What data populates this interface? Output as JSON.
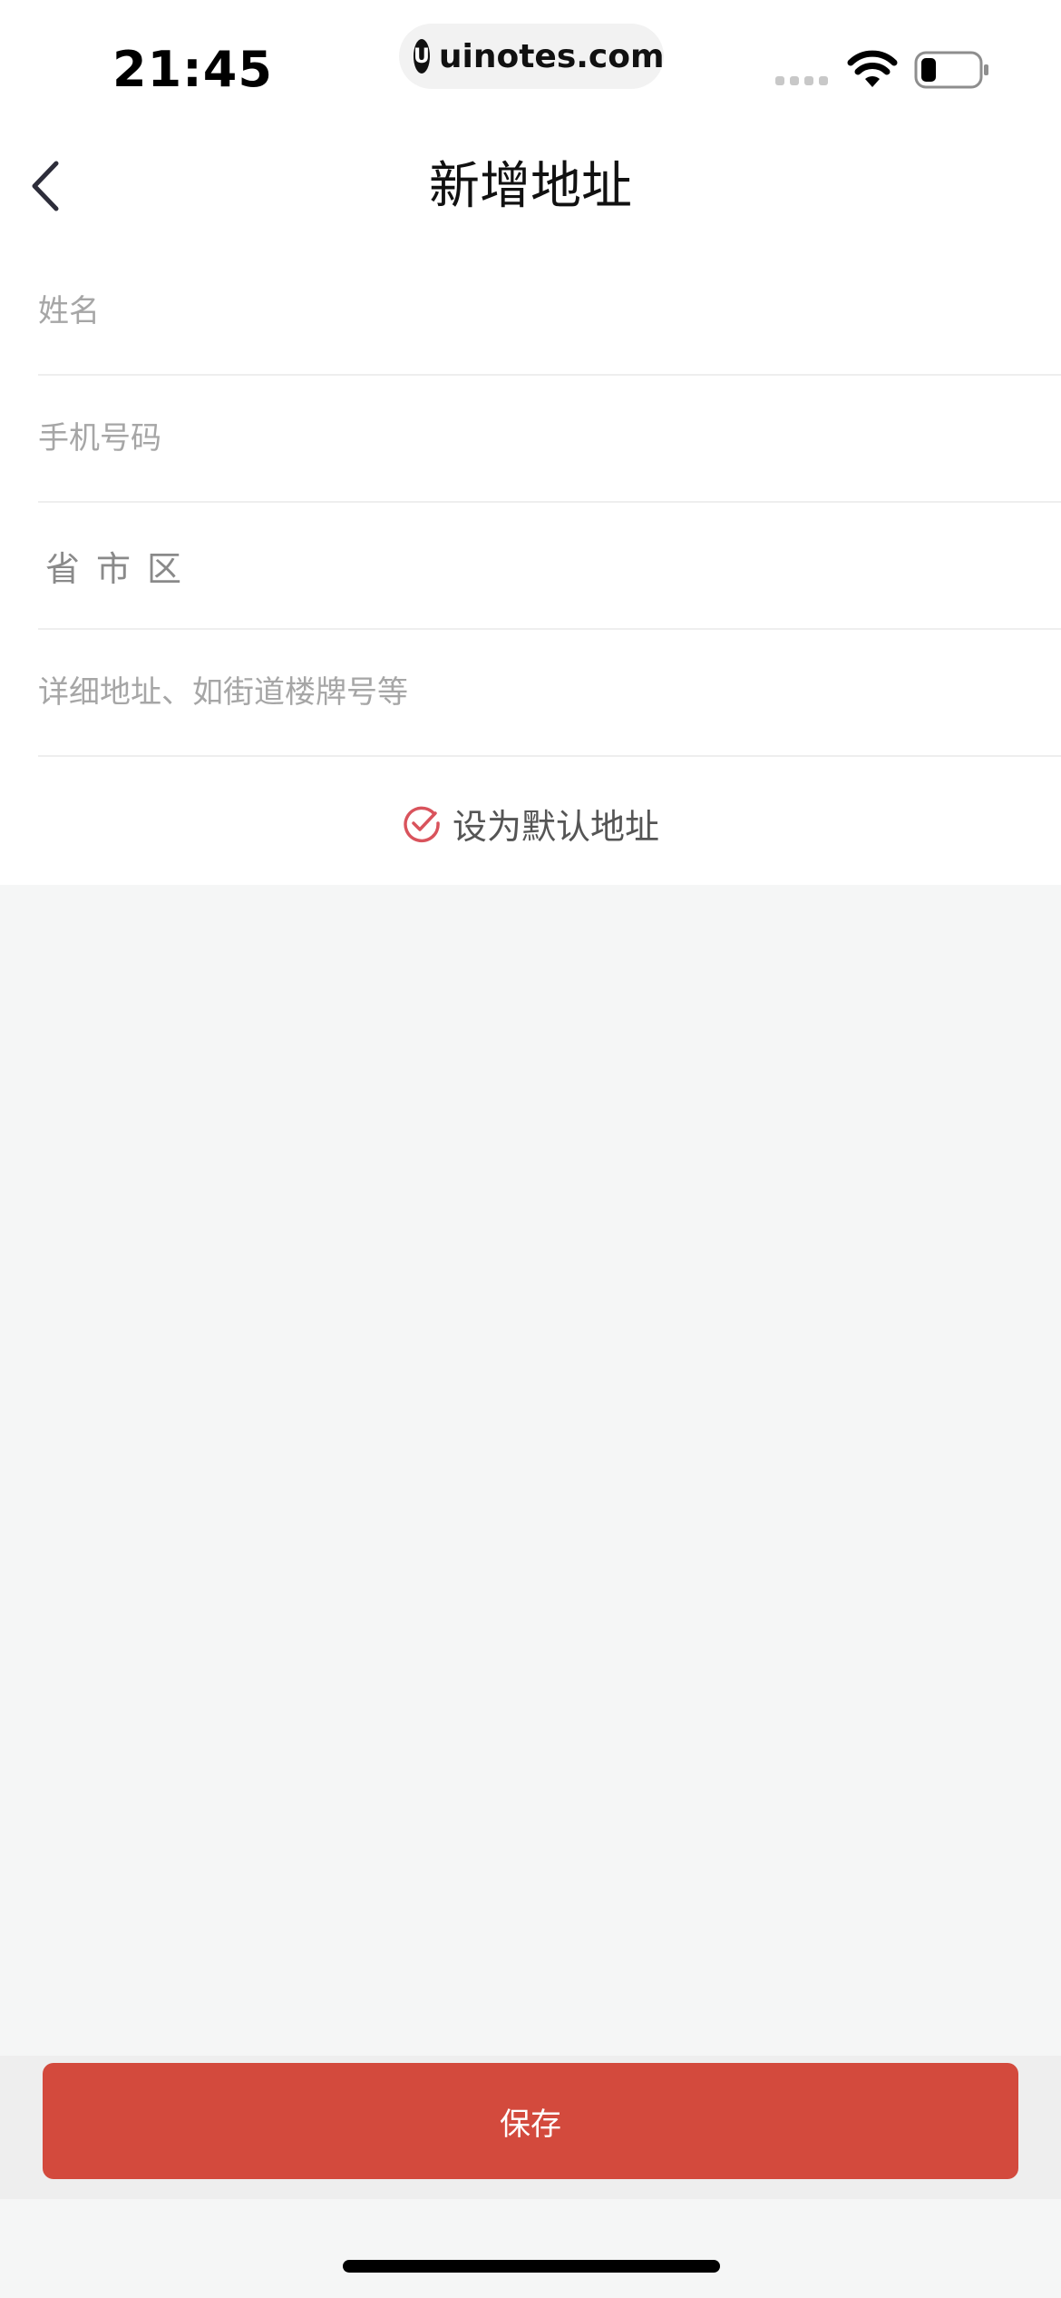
{
  "status_bar": {
    "time": "21:45",
    "url": "uinotes.com",
    "url_logo_letter": "U"
  },
  "nav": {
    "back_icon": "chevron-left-icon",
    "title": "新增地址"
  },
  "form": {
    "name_placeholder": "姓名",
    "phone_placeholder": "手机号码",
    "region_label": "省市区",
    "address_placeholder": "详细地址、如街道楼牌号等",
    "default_label": "设为默认地址",
    "default_checked": true
  },
  "footer": {
    "save_label": "保存"
  },
  "colors": {
    "accent": "#d34a3d",
    "check": "#d9535c",
    "page_bg": "#f5f6f6"
  }
}
